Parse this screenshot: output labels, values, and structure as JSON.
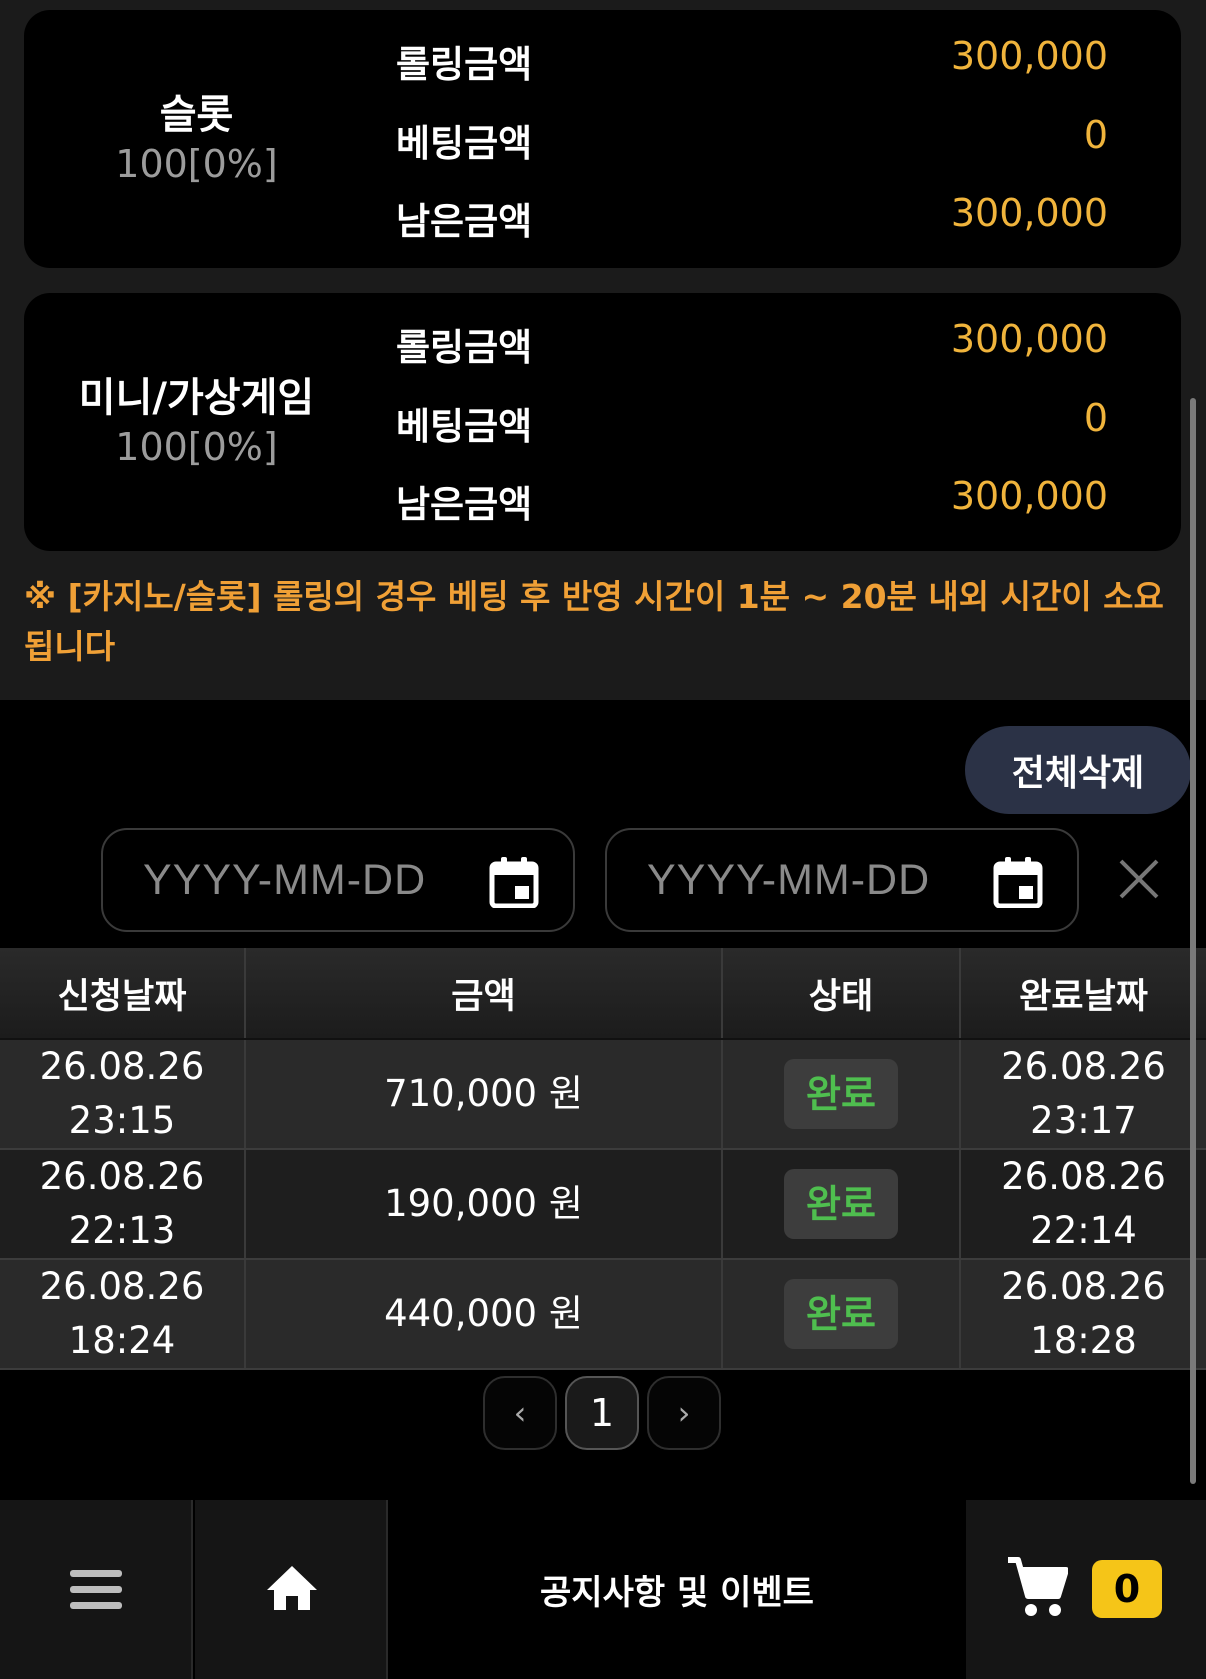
{
  "rolling_cards": [
    {
      "name": "슬롯",
      "rate": "100[0%]",
      "rows": [
        {
          "label": "롤링금액",
          "value": "300,000"
        },
        {
          "label": "베팅금액",
          "value": "0"
        },
        {
          "label": "남은금액",
          "value": "300,000"
        }
      ]
    },
    {
      "name": "미니/가상게임",
      "rate": "100[0%]",
      "rows": [
        {
          "label": "롤링금액",
          "value": "300,000"
        },
        {
          "label": "베팅금액",
          "value": "0"
        },
        {
          "label": "남은금액",
          "value": "300,000"
        }
      ]
    }
  ],
  "notice": "※ [카지노/슬롯] 롤링의 경우 베팅 후 반영 시간이 1분 ~ 20분 내외 시간이 소요됩니다",
  "delete_all_label": "전체삭제",
  "date_filter": {
    "start_placeholder": "YYYY-MM-DD",
    "end_placeholder": "YYYY-MM-DD"
  },
  "table": {
    "headers": [
      "신청날짜",
      "금액",
      "상태",
      "완료날짜"
    ],
    "rows": [
      {
        "request_date": "26.08.26",
        "request_time": "23:15",
        "amount": "710,000 원",
        "status": "완료",
        "done_date": "26.08.26",
        "done_time": "23:17"
      },
      {
        "request_date": "26.08.26",
        "request_time": "22:13",
        "amount": "190,000 원",
        "status": "완료",
        "done_date": "26.08.26",
        "done_time": "22:14"
      },
      {
        "request_date": "26.08.26",
        "request_time": "18:24",
        "amount": "440,000 원",
        "status": "완료",
        "done_date": "26.08.26",
        "done_time": "18:28"
      }
    ]
  },
  "pagination": {
    "prev": "‹",
    "current": "1",
    "next": "›"
  },
  "bottom_nav": {
    "notice_label": "공지사항 및 이벤트",
    "cart_count": "0"
  },
  "colors": {
    "accent_value": "#f0b43c",
    "notice": "#f0a036",
    "status_done": "#4fbf4f",
    "cart_badge": "#f5c518"
  }
}
